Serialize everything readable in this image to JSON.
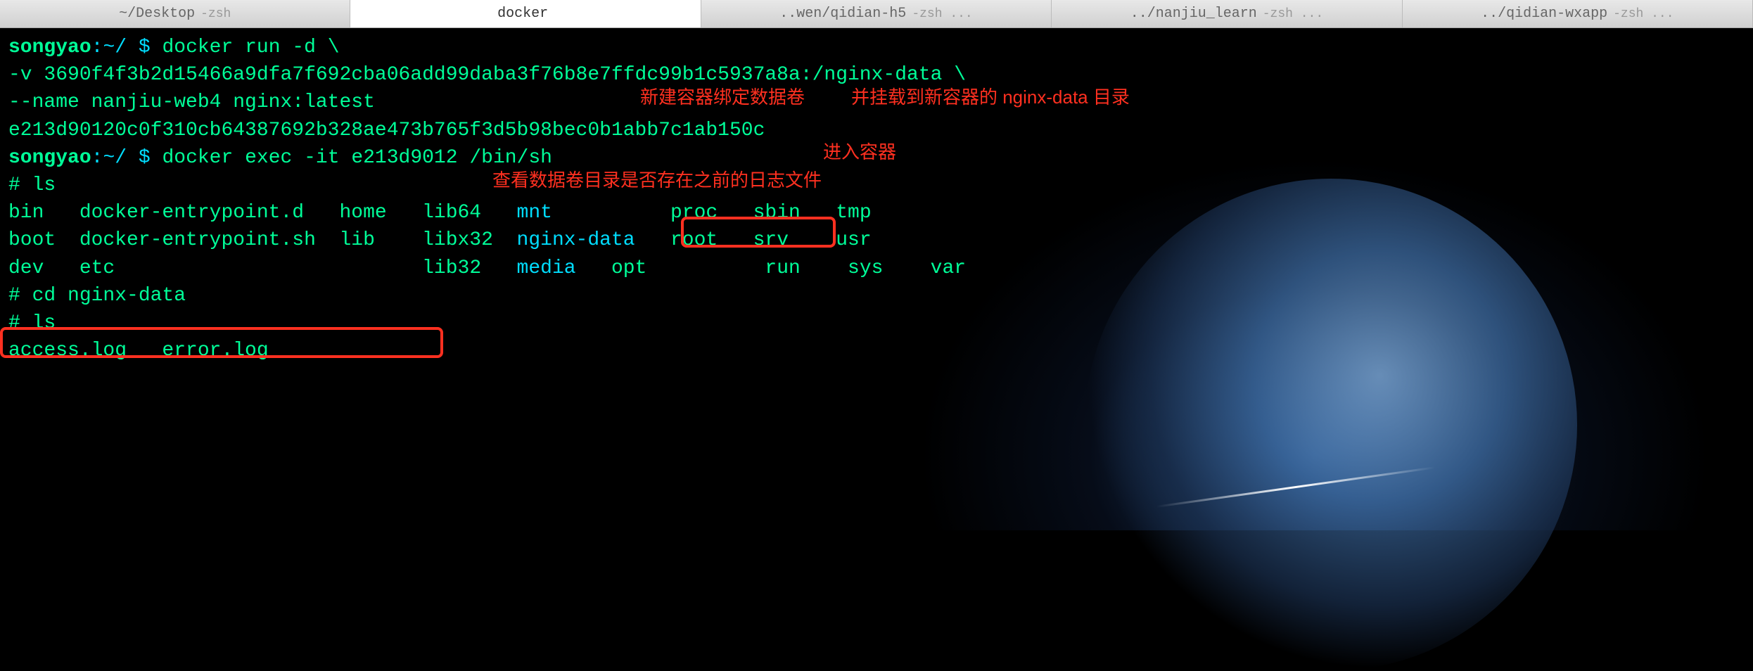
{
  "tabs": [
    {
      "label": "~/Desktop",
      "shell": "-zsh",
      "active": false
    },
    {
      "label": "docker",
      "shell": "",
      "active": true
    },
    {
      "label": "..wen/qidian-h5",
      "shell": "-zsh ...",
      "active": false
    },
    {
      "label": "../nanjiu_learn",
      "shell": "-zsh ...",
      "active": false
    },
    {
      "label": "../qidian-wxapp",
      "shell": "-zsh ...",
      "active": false
    }
  ],
  "lines": {
    "l1_user": "songyao",
    "l1_sep": ":",
    "l1_path": "~/",
    "l1_prompt": " $ ",
    "l1_cmd": "docker run -d \\",
    "l2": "-v 3690f4f3b2d15466a9dfa7f692cba06add99daba3f76b8e7ffdc99b1c5937a8a:/nginx-data \\",
    "l3": "--name nanjiu-web4 nginx:latest",
    "l4": "e213d90120c0f310cb64387692b328ae473b765f3d5b98bec0b1abb7c1ab150c",
    "l5_user": "songyao",
    "l5_sep": ":",
    "l5_path": "~/",
    "l5_prompt": " $ ",
    "l5_cmd": "docker exec -it e213d9012 /bin/sh",
    "l6": "# ls",
    "ls1": "bin   docker-entrypoint.d   home   lib64   ",
    "ls1_mnt": "mnt",
    "ls1_rest": "          proc   sbin   tmp",
    "ls2": "boot  docker-entrypoint.sh  lib    libx32  ",
    "ls2_nginx": "nginx-data",
    "ls2_rest": "   root   srv    usr",
    "ls3": "dev   etc                   ",
    "ls3_lib32": "       lib32   ",
    "ls3_media": "media",
    "ls3_opt": "   opt",
    "ls3_rest": "          run    sys    var",
    "l10": "# cd nginx-data",
    "l11": "# ls",
    "l12": "access.log   error.log"
  },
  "annotations": {
    "a1": "新建容器绑定数据卷",
    "a2": "并挂载到新容器的 nginx-data 目录",
    "a3": "进入容器",
    "a4": "查看数据卷目录是否存在之前的日志文件"
  }
}
